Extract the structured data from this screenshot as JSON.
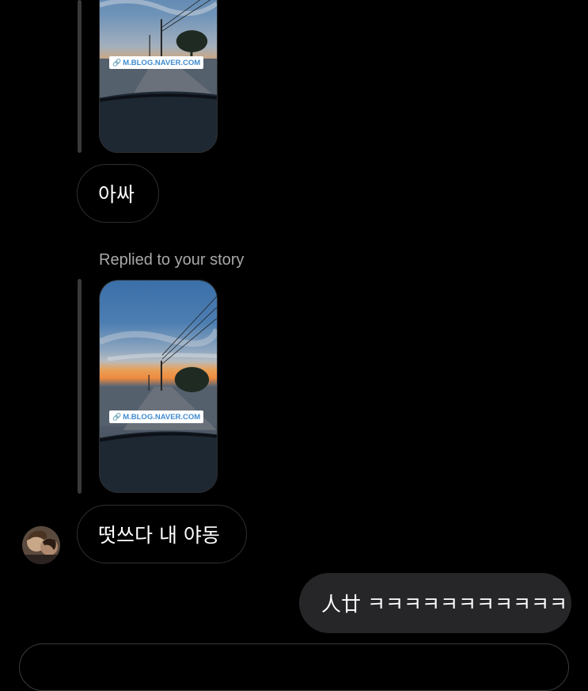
{
  "thread": {
    "story_link_1": "M.BLOG.NAVER.COM",
    "message_1": "아싸",
    "replied_label": "Replied to your story",
    "story_link_2": "M.BLOG.NAVER.COM",
    "message_2": "떳쓰다 내 야동",
    "message_3": "人廿 ㅋㅋㅋㅋㅋㅋㅋㅋㅋㅋㅋ"
  },
  "icons": {
    "link": "link-icon",
    "avatar": "avatar"
  }
}
